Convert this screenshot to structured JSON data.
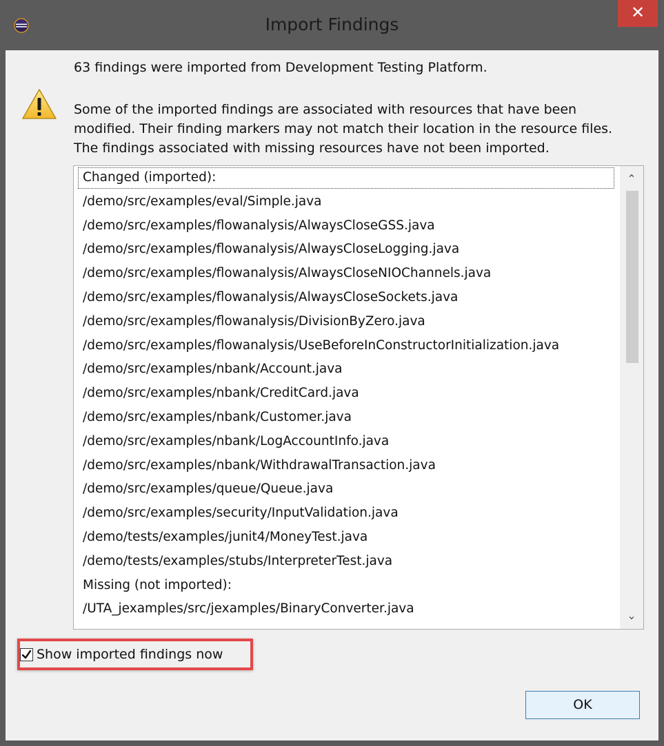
{
  "window": {
    "title": "Import Findings",
    "close_label": "✕",
    "app_icon": "eclipse-icon"
  },
  "colors": {
    "titlebar": "#5b5b5b",
    "close_button": "#c7413a",
    "dialog_background": "#f0f0f0",
    "highlight_border": "#e2484a",
    "ok_button_border": "#3c7fb1"
  },
  "message": {
    "summary": "63 findings were imported from Development Testing Platform.",
    "warning_icon": "warning-icon",
    "warning_lines": [
      "Some of the imported findings are associated with resources that have been",
      "modified. Their finding markers may not match their location in the resource files.",
      "The findings associated with missing resources have not been imported."
    ]
  },
  "list": {
    "items": [
      "Changed (imported):",
      "/demo/src/examples/eval/Simple.java",
      "/demo/src/examples/flowanalysis/AlwaysCloseGSS.java",
      "/demo/src/examples/flowanalysis/AlwaysCloseLogging.java",
      "/demo/src/examples/flowanalysis/AlwaysCloseNIOChannels.java",
      "/demo/src/examples/flowanalysis/AlwaysCloseSockets.java",
      "/demo/src/examples/flowanalysis/DivisionByZero.java",
      "/demo/src/examples/flowanalysis/UseBeforeInConstructorInitialization.java",
      "/demo/src/examples/nbank/Account.java",
      "/demo/src/examples/nbank/CreditCard.java",
      "/demo/src/examples/nbank/Customer.java",
      "/demo/src/examples/nbank/LogAccountInfo.java",
      "/demo/src/examples/nbank/WithdrawalTransaction.java",
      "/demo/src/examples/queue/Queue.java",
      "/demo/src/examples/security/InputValidation.java",
      "/demo/tests/examples/junit4/MoneyTest.java",
      "/demo/tests/examples/stubs/InterpreterTest.java",
      "Missing (not imported):",
      "/UTA_jexamples/src/jexamples/BinaryConverter.java"
    ],
    "scroll_up": "⌃",
    "scroll_down": "⌄"
  },
  "options": {
    "show_now_label": "Show imported findings now",
    "show_now_checked": true
  },
  "buttons": {
    "ok_label": "OK"
  }
}
